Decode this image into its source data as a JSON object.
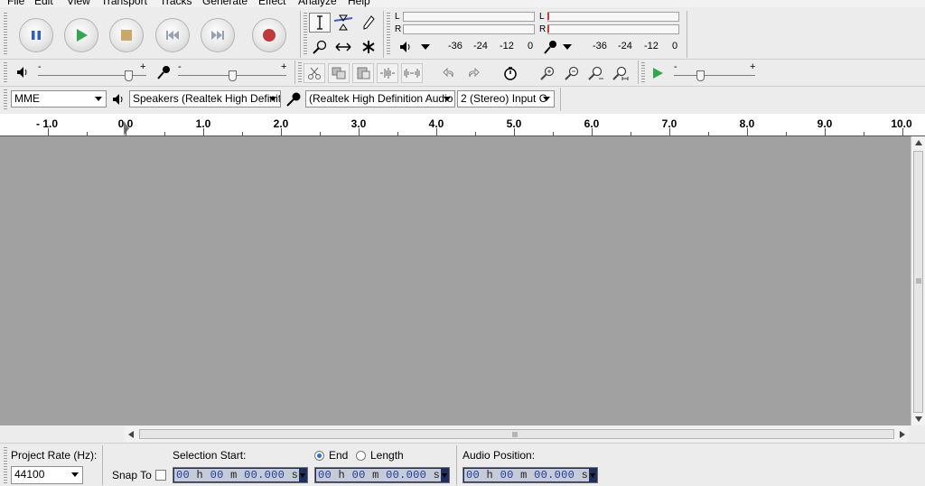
{
  "menu": [
    "File",
    "Edit",
    "View",
    "Transport",
    "Tracks",
    "Generate",
    "Effect",
    "Analyze",
    "Help"
  ],
  "meters": {
    "play": {
      "channels": [
        "L",
        "R"
      ],
      "scale": [
        "-36",
        "-24",
        "-12",
        "0"
      ]
    },
    "record": {
      "channels": [
        "L",
        "R"
      ],
      "scale": [
        "-36",
        "-24",
        "-12",
        "0"
      ]
    }
  },
  "mixer": {
    "minus": "-",
    "plus": "+"
  },
  "device": {
    "host": "MME",
    "playback": "Speakers (Realtek High Definit",
    "recording": "(Realtek High Definition Audio",
    "channels": "2 (Stereo) Input C"
  },
  "ruler": {
    "labels": [
      "- 1.0",
      "0.0",
      "1.0",
      "2.0",
      "3.0",
      "4.0",
      "5.0",
      "6.0",
      "7.0",
      "8.0",
      "9.0",
      "10.0"
    ]
  },
  "selection_bar": {
    "project_rate_label": "Project Rate (Hz):",
    "project_rate_value": "44100",
    "snap_to_label": "Snap To",
    "selection_start_label": "Selection Start:",
    "end_label": "End",
    "length_label": "Length",
    "audio_position_label": "Audio Position:",
    "time_parts": {
      "hh": "00",
      "h": "h",
      "mm": "00",
      "m": "m",
      "ss": "00.000",
      "s": "s"
    }
  },
  "colors": {
    "track_bg": "#a1a1a1",
    "time_text": "#1e3a9e",
    "play_green": "#2fa84f",
    "record_red": "#c0393b",
    "pause_blue": "#2b5cc7"
  }
}
